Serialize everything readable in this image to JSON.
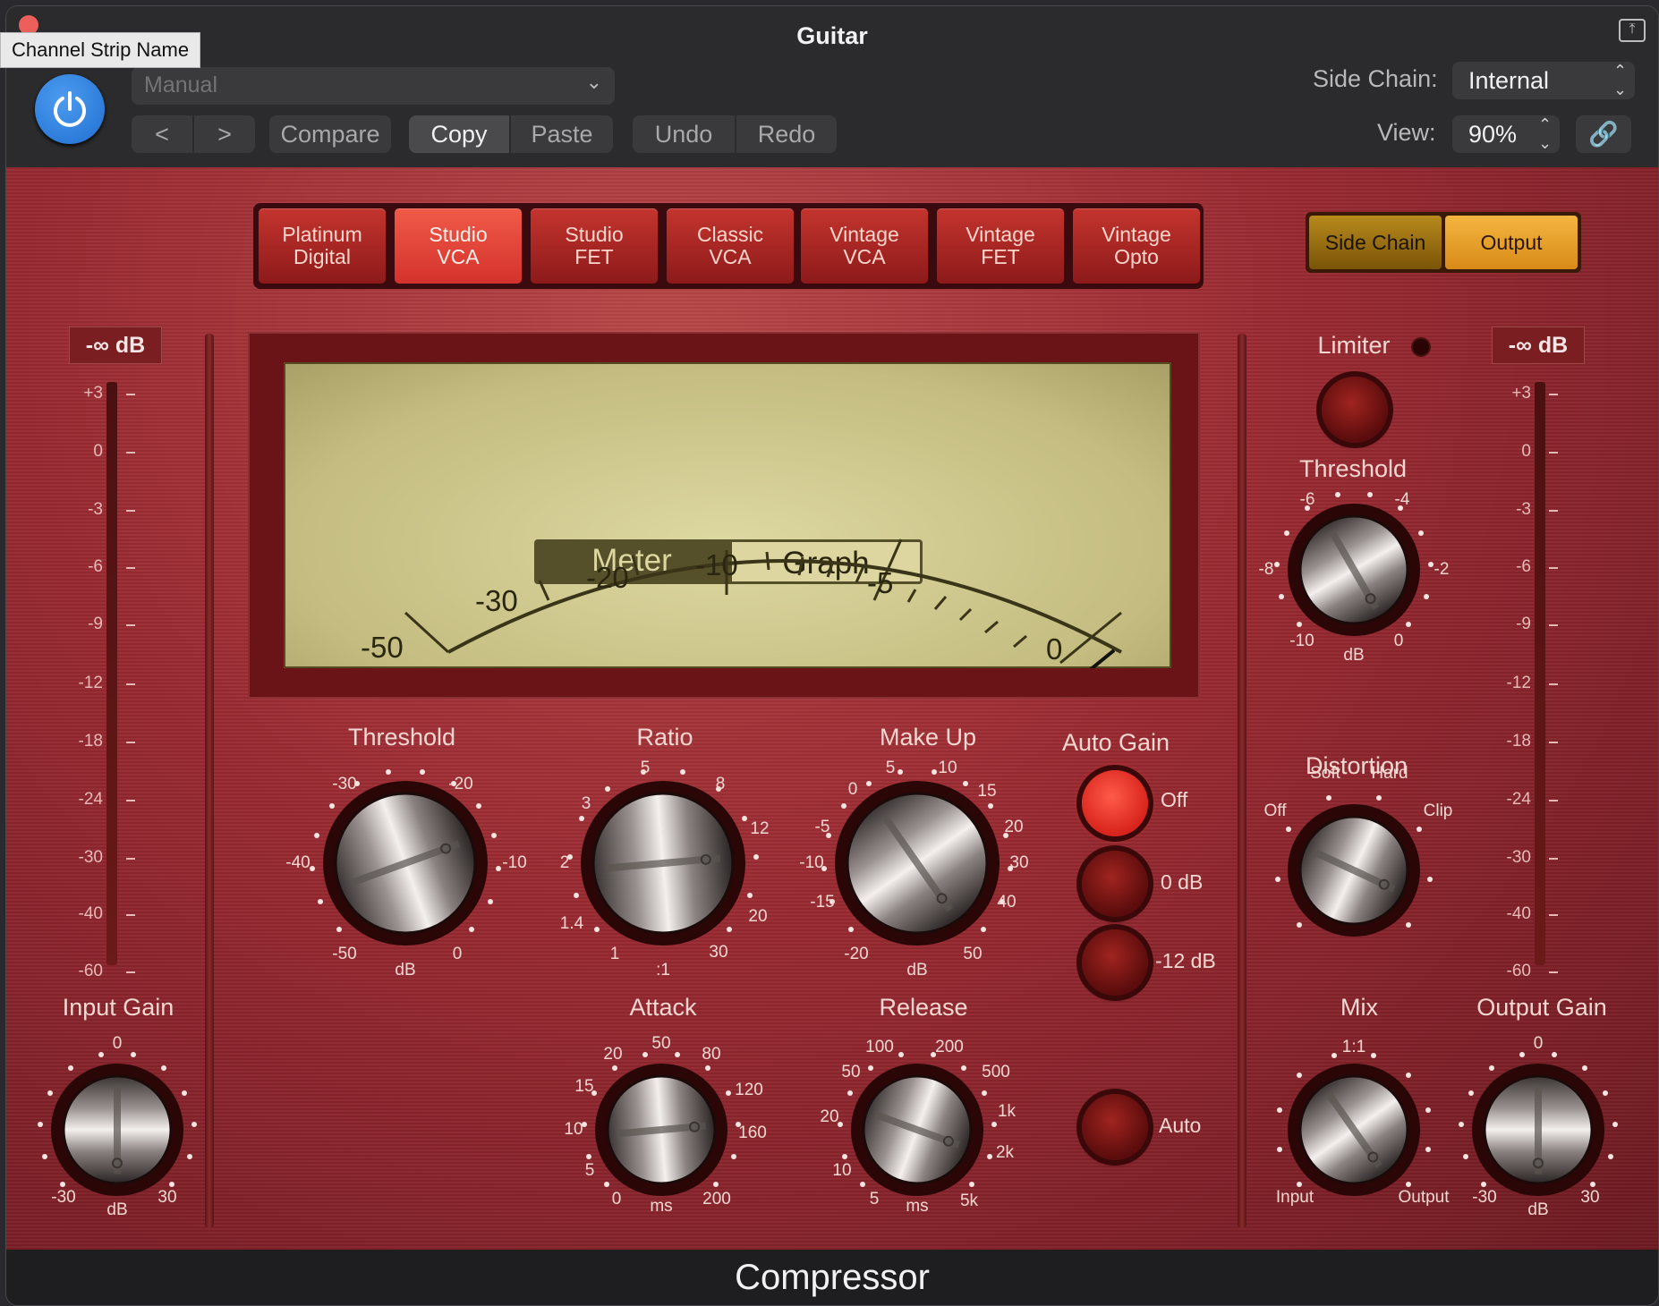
{
  "window": {
    "title": "Guitar",
    "tooltip": "Channel Strip Name",
    "footer": "Compressor"
  },
  "header": {
    "preset": "Manual",
    "prev": "<",
    "next": ">",
    "compare": "Compare",
    "copy": "Copy",
    "paste": "Paste",
    "undo": "Undo",
    "redo": "Redo",
    "side_chain_label": "Side Chain:",
    "side_chain_value": "Internal",
    "view_label": "View:",
    "view_value": "90%"
  },
  "circuits": [
    {
      "line1": "Platinum",
      "line2": "Digital"
    },
    {
      "line1": "Studio",
      "line2": "VCA"
    },
    {
      "line1": "Studio",
      "line2": "FET"
    },
    {
      "line1": "Classic",
      "line2": "VCA"
    },
    {
      "line1": "Vintage",
      "line2": "VCA"
    },
    {
      "line1": "Vintage",
      "line2": "FET"
    },
    {
      "line1": "Vintage",
      "line2": "Opto"
    }
  ],
  "selected_circuit": "Studio VCA",
  "side_panel": {
    "side_chain": "Side Chain",
    "output": "Output",
    "selected": "Output"
  },
  "meters": {
    "input_db": "-∞ dB",
    "output_db": "-∞ dB",
    "scale": [
      "+3",
      "0",
      "-3",
      "-6",
      "-9",
      "-12",
      "-18",
      "-24",
      "-30",
      "-40",
      "-60"
    ]
  },
  "display": {
    "meter_tab": "Meter",
    "graph_tab": "Graph",
    "selected": "Meter",
    "scale": [
      "-50",
      "-30",
      "-20",
      "-10",
      "-5",
      "0"
    ]
  },
  "threshold": {
    "label": "Threshold",
    "ticks": [
      "-30",
      "-20",
      "-40",
      "-10",
      "-50",
      "0"
    ],
    "unit": "dB"
  },
  "ratio": {
    "label": "Ratio",
    "ticks": [
      "5",
      "8",
      "3",
      "12",
      "2",
      "20",
      "1.4",
      "30",
      "1"
    ],
    "unit": ":1"
  },
  "makeup": {
    "label": "Make Up",
    "ticks": [
      "5",
      "10",
      "0",
      "15",
      "-5",
      "20",
      "-10",
      "30",
      "-15",
      "40",
      "-20",
      "50"
    ],
    "unit": "dB"
  },
  "auto_gain": {
    "label": "Auto Gain",
    "off": "Off",
    "zero": "0 dB",
    "minus12": "-12 dB",
    "selected": "Off"
  },
  "attack": {
    "label": "Attack",
    "ticks": [
      "50",
      "20",
      "80",
      "15",
      "120",
      "10",
      "160",
      "5",
      "0",
      "200"
    ],
    "unit": "ms"
  },
  "release": {
    "label": "Release",
    "ticks": [
      "100",
      "200",
      "50",
      "500",
      "20",
      "1k",
      "10",
      "2k",
      "5",
      "5k"
    ],
    "unit": "ms",
    "auto": "Auto"
  },
  "limiter": {
    "label": "Limiter",
    "threshold_label": "Threshold",
    "ticks": [
      "-6",
      "-4",
      "-8",
      "-2",
      "-10",
      "0"
    ],
    "unit": "dB"
  },
  "distortion": {
    "label": "Distortion",
    "soft": "Soft",
    "hard": "Hard",
    "off": "Off",
    "clip": "Clip"
  },
  "mix": {
    "label": "Mix",
    "ratio": "1:1",
    "input": "Input",
    "output": "Output"
  },
  "input_gain": {
    "label": "Input Gain",
    "ticks": [
      "0",
      "-30",
      "30"
    ],
    "unit": "dB"
  },
  "output_gain": {
    "label": "Output Gain",
    "ticks": [
      "0",
      "-30",
      "30"
    ],
    "unit": "dB"
  }
}
